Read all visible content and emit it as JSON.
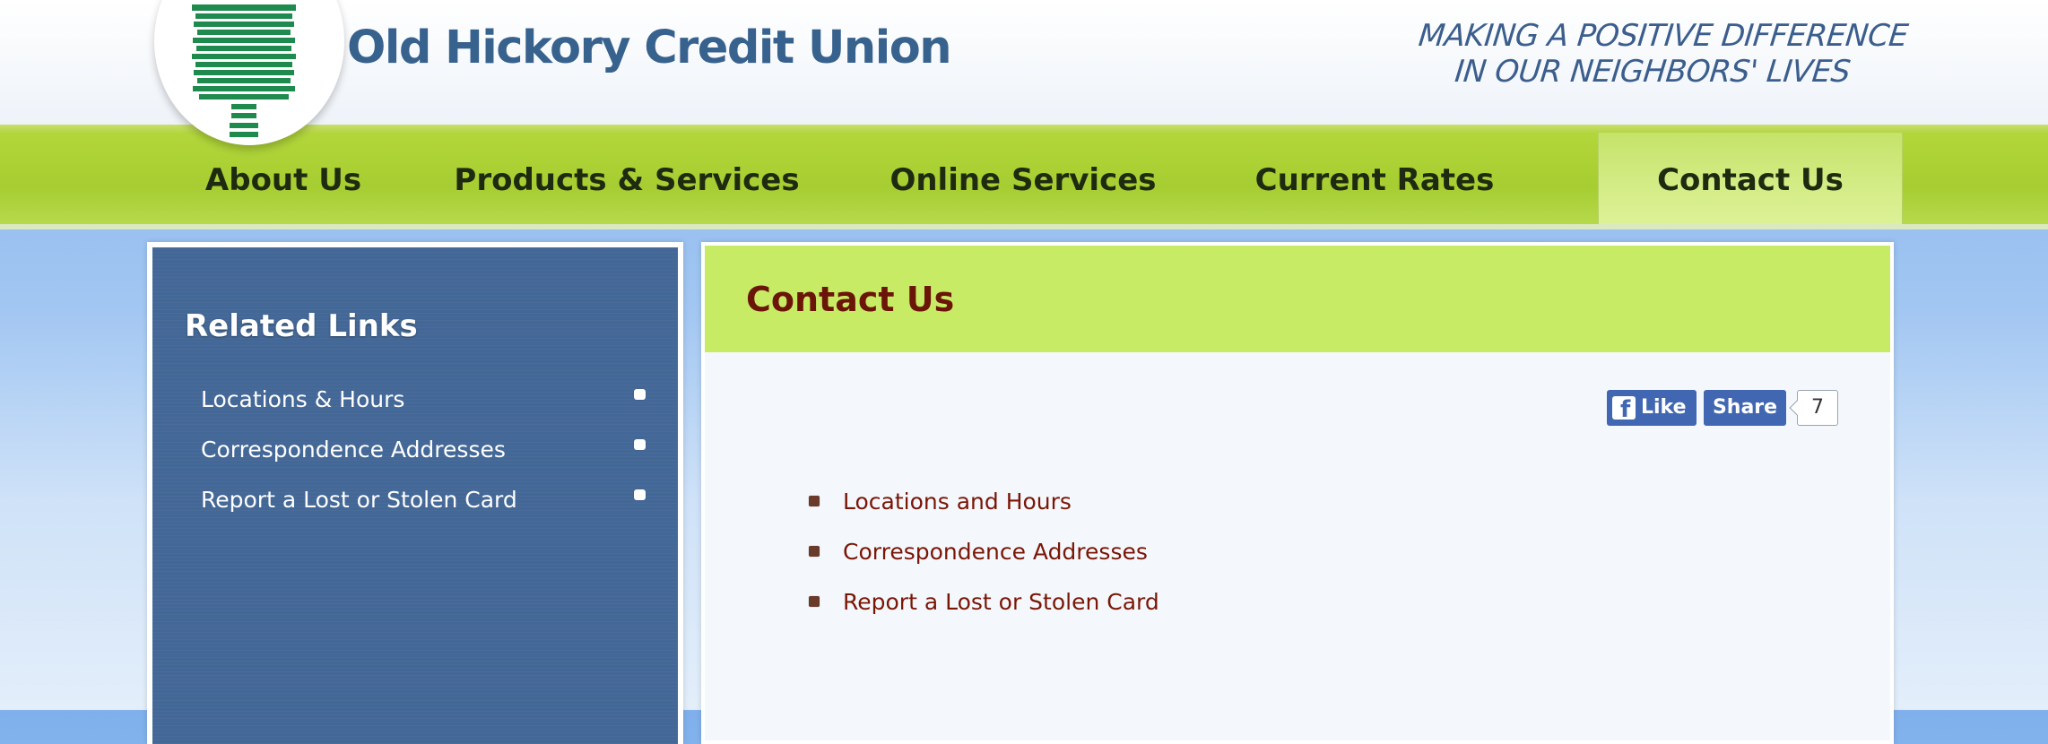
{
  "brand": {
    "name": "Old Hickory Credit Union",
    "tagline_lines": [
      "MAKING A POSITIVE DIFFERENCE",
      "IN OUR NEIGHBORS' LIVES"
    ]
  },
  "nav": {
    "items": [
      {
        "label": "About Us"
      },
      {
        "label": "Products & Services"
      },
      {
        "label": "Online Services"
      },
      {
        "label": "Current Rates"
      },
      {
        "label": "Contact Us"
      }
    ],
    "active": "Contact Us"
  },
  "sidebar": {
    "title": "Related Links",
    "items": [
      {
        "label": "Locations & Hours"
      },
      {
        "label": "Correspondence Addresses"
      },
      {
        "label": "Report a Lost or Stolen Card"
      }
    ]
  },
  "main": {
    "title": "Contact Us",
    "social": {
      "like_label": "Like",
      "share_label": "Share",
      "count": "7"
    },
    "links": [
      {
        "label": "Locations and Hours"
      },
      {
        "label": "Correspondence Addresses"
      },
      {
        "label": "Report a Lost or Stolen Card"
      }
    ]
  },
  "colors": {
    "brand_blue": "#38628e",
    "nav_green": "#a6cd31",
    "sidebar_blue": "#436796",
    "content_header_green": "#c8eb66",
    "title_maroon": "#6b1408",
    "facebook_blue": "#4267b2"
  },
  "icons": {
    "logo": "tree-logo-icon",
    "facebook": "facebook-icon"
  }
}
